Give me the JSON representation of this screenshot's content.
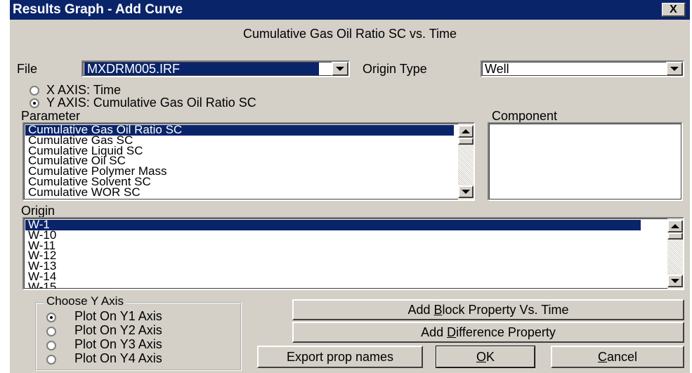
{
  "window": {
    "title": "Results Graph - Add Curve",
    "close_label": "X"
  },
  "subtitle": "Cumulative Gas Oil Ratio SC vs. Time",
  "file": {
    "label": "File",
    "value": "MXDRM005.IRF"
  },
  "origin_type": {
    "label": "Origin Type",
    "value": "Well"
  },
  "axes": {
    "x_label": "X AXIS: Time",
    "y_label": "Y AXIS: Cumulative Gas Oil Ratio SC",
    "selected": "y"
  },
  "parameter": {
    "label": "Parameter",
    "items": [
      "Cumulative Gas Oil Ratio SC",
      "Cumulative Gas SC",
      "Cumulative Liquid SC",
      "Cumulative Oil SC",
      "Cumulative Polymer Mass",
      "Cumulative Solvent SC",
      "Cumulative WOR SC"
    ],
    "selected_index": 0
  },
  "component": {
    "label": "Component"
  },
  "origin": {
    "label": "Origin",
    "items": [
      "W-1",
      "W-10",
      "W-11",
      "W-12",
      "W-13",
      "W-14",
      "W-15"
    ],
    "selected_index": 0
  },
  "y_axis_group": {
    "label": "Choose Y Axis",
    "options": [
      "Plot On Y1 Axis",
      "Plot On Y2 Axis",
      "Plot On Y3 Axis",
      "Plot On Y4 Axis"
    ],
    "selected_index": 0
  },
  "buttons": {
    "add_block_a": "Add ",
    "add_block_u": "B",
    "add_block_b": "lock Property Vs. Time",
    "add_diff_a": "Add ",
    "add_diff_u": "D",
    "add_diff_b": "ifference Property",
    "export": "Export prop names",
    "ok_u": "O",
    "ok_b": "K",
    "cancel_u": "C",
    "cancel_b": "ancel"
  },
  "colors": {
    "title_bg": "#0a246a",
    "dialog_bg": "#d4d0c8",
    "selection": "#0a246a"
  }
}
